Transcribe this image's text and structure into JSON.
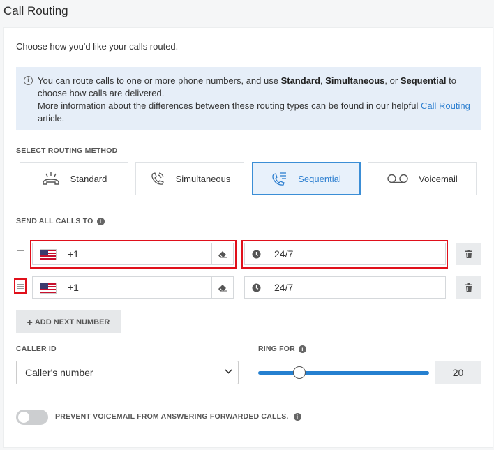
{
  "page_title": "Call Routing",
  "intro": "Choose how you'd like your calls routed.",
  "info": {
    "line1_a": "You can route calls to one or more phone numbers, and use ",
    "standard": "Standard",
    "comma": ", ",
    "simultaneous": "Simultaneous",
    "or": ", or ",
    "sequential": "Sequential",
    "line1_b": " to",
    "line2": "choose how calls are delivered.",
    "line3": "More information about the differences between these routing types can be found in our helpful ",
    "link": "Call Routing",
    "line3_end": " article."
  },
  "routing_method": {
    "label": "SELECT ROUTING METHOD",
    "options": [
      {
        "label": "Standard",
        "icon": "phone-ringing-icon"
      },
      {
        "label": "Simultaneous",
        "icon": "phone-vibrate-icon"
      },
      {
        "label": "Sequential",
        "icon": "phone-list-icon",
        "selected": true
      },
      {
        "label": "Voicemail",
        "icon": "voicemail-icon"
      }
    ]
  },
  "send_calls": {
    "label": "SEND ALL CALLS TO",
    "rows": [
      {
        "country_code": "+1",
        "schedule": "24/7"
      },
      {
        "country_code": "+1",
        "schedule": "24/7"
      }
    ],
    "add_button": "ADD NEXT NUMBER",
    "add_prefix": "+"
  },
  "caller_id": {
    "label": "CALLER ID",
    "value": "Caller's number"
  },
  "ring_for": {
    "label": "RING FOR",
    "value": "20",
    "slider_fraction": 0.25
  },
  "prevent_voicemail": {
    "label": "PREVENT VOICEMAIL FROM ANSWERING FORWARDED CALLS.",
    "enabled": false
  },
  "colors": {
    "accent": "#2d7fd0",
    "highlight": "#e0101b",
    "info_bg": "#e6eef8"
  }
}
